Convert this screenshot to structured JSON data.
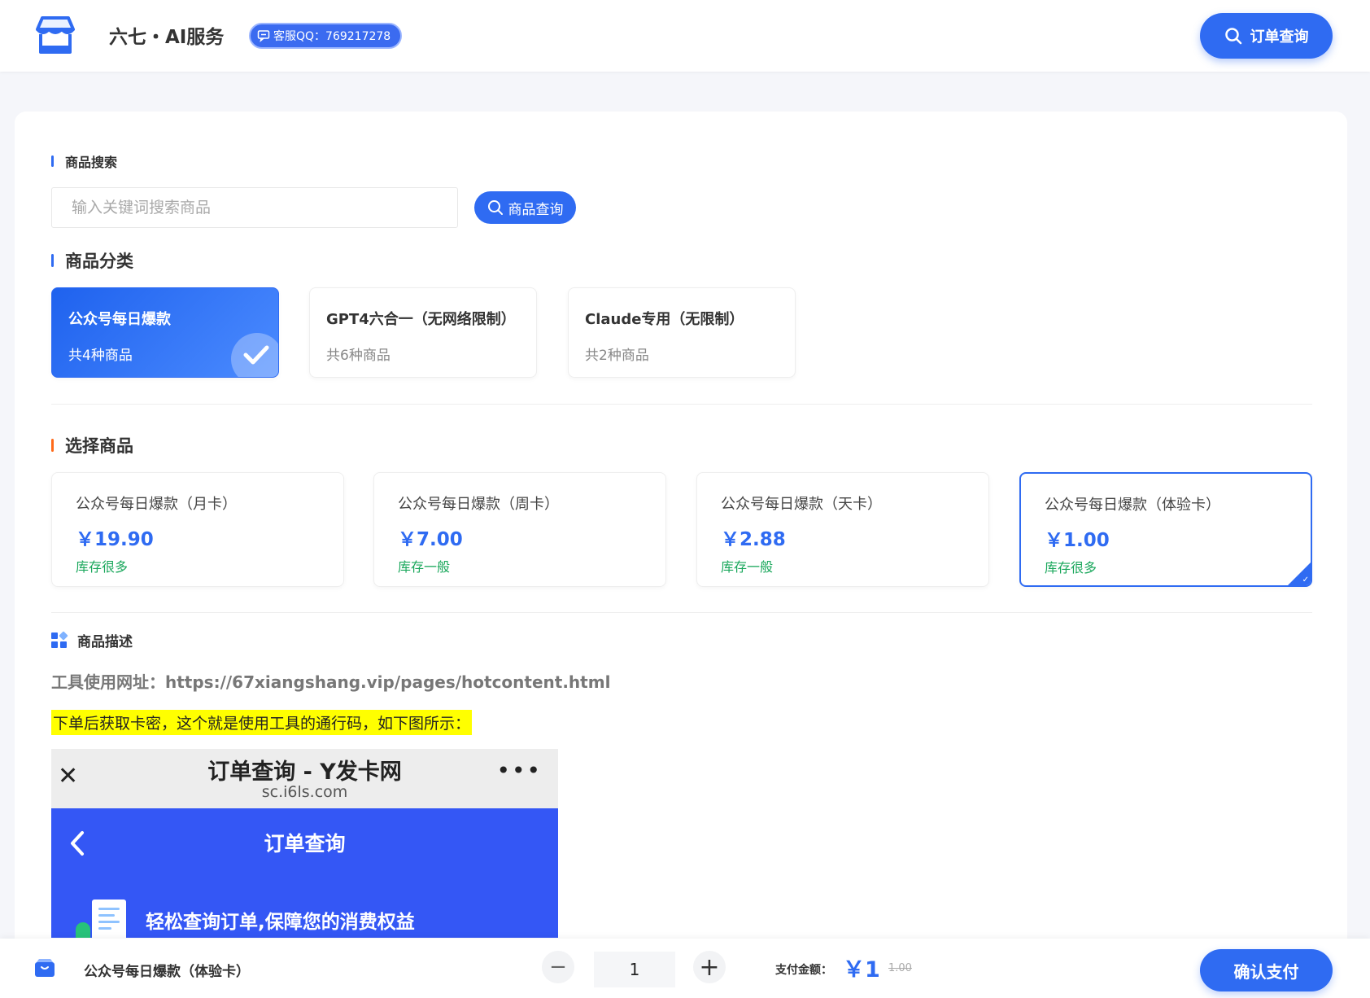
{
  "header": {
    "site_title": "六七・AI服务",
    "qq_label": "客服QQ：769217278",
    "order_query": "订单查询"
  },
  "search": {
    "section_title": "商品搜索",
    "placeholder": "输入关键词搜索商品",
    "button": "商品查询"
  },
  "categories": {
    "section_title": "商品分类",
    "items": [
      {
        "name": "公众号每日爆款",
        "count": "共4种商品",
        "active": true
      },
      {
        "name": "GPT4六合一（无网络限制）",
        "count": "共6种商品",
        "active": false
      },
      {
        "name": "Claude专用（无限制）",
        "count": "共2种商品",
        "active": false
      }
    ]
  },
  "products": {
    "section_title": "选择商品",
    "items": [
      {
        "name": "公众号每日爆款（月卡）",
        "price": "￥19.90",
        "stock": "库存很多",
        "selected": false
      },
      {
        "name": "公众号每日爆款（周卡）",
        "price": "￥7.00",
        "stock": "库存一般",
        "selected": false
      },
      {
        "name": "公众号每日爆款（天卡）",
        "price": "￥2.88",
        "stock": "库存一般",
        "selected": false
      },
      {
        "name": "公众号每日爆款（体验卡）",
        "price": "￥1.00",
        "stock": "库存很多",
        "selected": true
      }
    ]
  },
  "description": {
    "section_title": "商品描述",
    "url_line": "工具使用网址：https://67xiangshang.vip/pages/hotcontent.html",
    "note": "下单后获取卡密，这个就是使用工具的通行码，如下图所示：",
    "screenshot": {
      "title": "订单查询 - Y发卡网",
      "domain": "sc.i6ls.com",
      "heading": "订单查询",
      "slogan": "轻松查询订单,保障您的消费权益"
    }
  },
  "footer": {
    "product_name": "公众号每日爆款（体验卡）",
    "quantity": "1",
    "pay_label": "支付金额：",
    "pay_amount": "￥1",
    "original_price": "1.00",
    "confirm": "确认支付"
  },
  "colors": {
    "accent": "#2f6bf2",
    "stock_green": "#19a75b",
    "highlight": "#ffff00",
    "orange_bar": "#ff6a1a"
  }
}
